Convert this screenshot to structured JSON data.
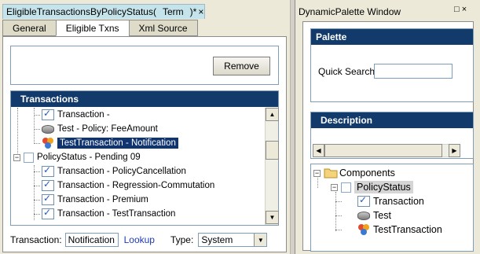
{
  "editor": {
    "document_tab": "EligibleTransactionsByPolicyStatus(",
    "term": "Term",
    "modified_marker": ")*",
    "close": "×",
    "sub_tabs": [
      "General",
      "Eligible Txns",
      "Xml Source"
    ],
    "active_sub_tab": "Eligible Txns",
    "remove_button": "Remove",
    "transactions": {
      "header": "Transactions",
      "rows": [
        {
          "label": "Transaction -",
          "icon": "transaction-icon"
        },
        {
          "label": "Test - Policy: FeeAmount",
          "icon": "test-icon"
        },
        {
          "label": "TestTransaction - Notification",
          "icon": "test-transaction-icon",
          "selected": true
        },
        {
          "label": "PolicyStatus - Pending 09",
          "icon": "policy-status-icon"
        },
        {
          "label": "Transaction - PolicyCancellation",
          "icon": "transaction-icon"
        },
        {
          "label": "Transaction - Regression-Commutation",
          "icon": "transaction-icon"
        },
        {
          "label": "Transaction - Premium",
          "icon": "transaction-icon"
        },
        {
          "label": "Transaction - TestTransaction",
          "icon": "transaction-icon"
        }
      ],
      "expander": "−"
    },
    "bottom": {
      "transaction_label": "Transaction:",
      "transaction_value": "Notification",
      "lookup": "Lookup",
      "type_label": "Type:",
      "type_value": "System"
    }
  },
  "palette": {
    "window_title": "DynamicPalette Window",
    "window_controls": "□ ×",
    "header": "Palette",
    "quick_search_label": "Quick Search:",
    "quick_search_value": "",
    "description_header": "Description",
    "components": {
      "root": "Components",
      "child": "PolicyStatus",
      "items": [
        "Transaction",
        "Test",
        "TestTransaction"
      ],
      "expander": "−"
    }
  }
}
